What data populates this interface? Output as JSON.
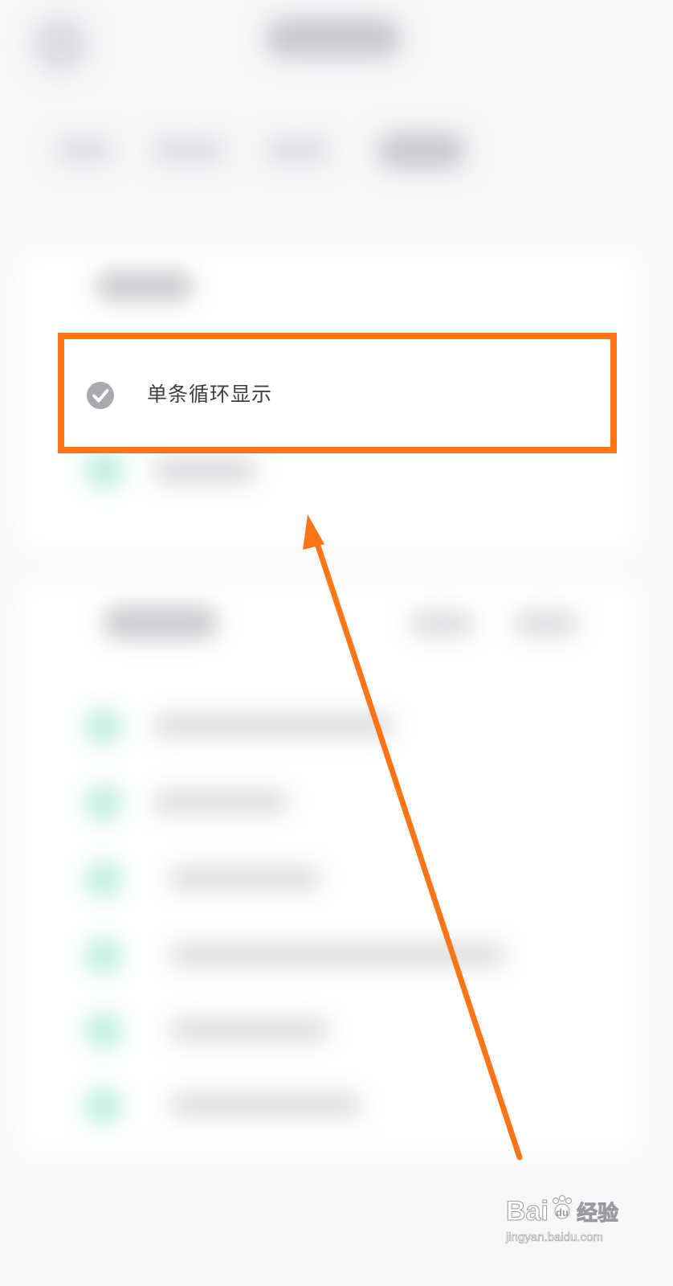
{
  "option": {
    "label": "单条循环显示",
    "selected": true
  },
  "annotation": {
    "highlight_color": "#ff7416",
    "arrow_color": "#ff7416"
  },
  "colors": {
    "background": "#f7f7f9",
    "card": "#ffffff",
    "check_icon": "#a8a8ad",
    "label_text": "#3e3e43"
  },
  "icons": {
    "option_check": "check-circle-icon",
    "watermark": "baidu-paw-icon"
  },
  "watermark": {
    "brand": "Bai",
    "brand_suffix": "du",
    "product": "经验",
    "url": "jingyan.baidu.com"
  }
}
